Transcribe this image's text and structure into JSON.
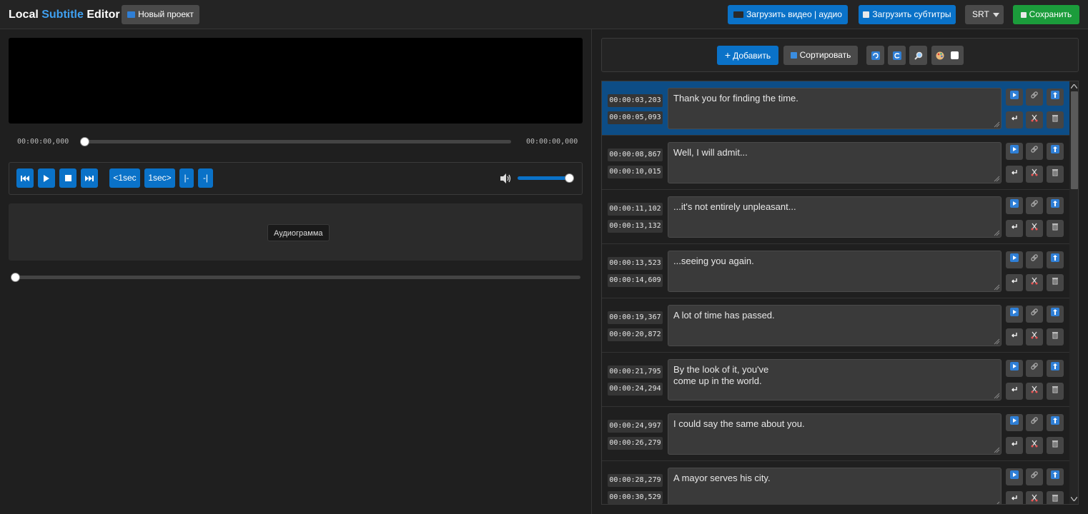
{
  "app": {
    "title_pre": "Local ",
    "title_hl": "Subtitle",
    "title_post": " Editor"
  },
  "header": {
    "new_project": "Новый проект",
    "load_media": "Загрузить видео | аудио",
    "load_subs": "Загрузить субтитры",
    "format": "SRT",
    "save": "Сохранить"
  },
  "player": {
    "current_time": "00:00:00,000",
    "duration": "00:00:00,000",
    "progress": 0,
    "back_1s": "<1sec",
    "fwd_1s": "1sec>",
    "mark_in": "|-",
    "mark_out": "-|",
    "volume": 1.0,
    "zoom": 0
  },
  "waveform": {
    "label": "Аудиограмма"
  },
  "toolbar": {
    "add": "Добавить",
    "sort": "Сортировать"
  },
  "colors": {
    "accent": "#0a72c8",
    "save": "#1b9c3b",
    "active_row": "#0d4d86"
  },
  "subtitles": [
    {
      "start": "00:00:03,203",
      "end": "00:00:05,093",
      "text": "Thank you for finding the time.",
      "active": true
    },
    {
      "start": "00:00:08,867",
      "end": "00:00:10,015",
      "text": "Well, I will admit..."
    },
    {
      "start": "00:00:11,102",
      "end": "00:00:13,132",
      "text": "...it's not entirely unpleasant..."
    },
    {
      "start": "00:00:13,523",
      "end": "00:00:14,609",
      "text": "...seeing you again."
    },
    {
      "start": "00:00:19,367",
      "end": "00:00:20,872",
      "text": "A lot of time has passed."
    },
    {
      "start": "00:00:21,795",
      "end": "00:00:24,294",
      "text": "By the look of it, you've\ncome up in the world."
    },
    {
      "start": "00:00:24,997",
      "end": "00:00:26,279",
      "text": "I could say the same about you."
    },
    {
      "start": "00:00:28,279",
      "end": "00:00:30,529",
      "text": "A mayor serves his city."
    }
  ]
}
